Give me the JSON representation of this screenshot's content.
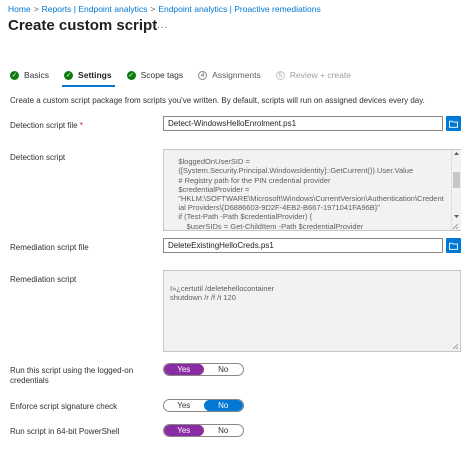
{
  "breadcrumb": {
    "items": [
      "Home",
      "Reports | Endpoint analytics",
      "Endpoint analytics | Proactive remediations"
    ],
    "separator": ">"
  },
  "page": {
    "title": "Create custom script",
    "more": "..."
  },
  "wizard": {
    "steps": [
      {
        "number": "1",
        "label": "Basics",
        "state": "done"
      },
      {
        "number": "2",
        "label": "Settings",
        "state": "current"
      },
      {
        "number": "3",
        "label": "Scope tags",
        "state": "done"
      },
      {
        "number": "4",
        "label": "Assignments",
        "state": "pending"
      },
      {
        "number": "5",
        "label": "Review + create",
        "state": "disabled"
      }
    ],
    "check": "✓"
  },
  "description": "Create a custom script package from scripts you've written. By default, scripts will run on assigned devices every day.",
  "form": {
    "detection_file": {
      "label": "Detection script file",
      "required_mark": "*",
      "value": "Detect-WindowsHelloEnrolment.ps1"
    },
    "detection_script": {
      "label": "Detection script",
      "lines": [
        "    $loggedOnUserSID =",
        "    ([System.Security.Principal.WindowsIdentity]::GetCurrent()).User.Value",
        "    # Registry path for the PIN credential provider",
        "    $credentialProvider =",
        "    \"HKLM:\\SOFTWARE\\Microsoft\\Windows\\CurrentVersion\\Authentication\\Credent",
        "    ial Providers\\{D6886603-9D2F-4EB2-B667-1971041FA96B}\"",
        "    if (Test-Path -Path $credentialProvider) {",
        "        $userSIDs = Get-ChildItem -Path $credentialProvider"
      ]
    },
    "remediation_file": {
      "label": "Remediation script file",
      "value": "DeleteExistingHelloCreds.ps1"
    },
    "remediation_script": {
      "label": "Remediation script",
      "lines": [
        "ï»¿certutil /deletehellocontainer",
        "shutdown /r /f /t 120"
      ]
    },
    "run_logged_on": {
      "label": "Run this script using the logged-on credentials",
      "yes": "Yes",
      "no": "No",
      "selected": "Yes",
      "accent": "#8a2da5"
    },
    "enforce_signature": {
      "label": "Enforce script signature check",
      "yes": "Yes",
      "no": "No",
      "selected": "No",
      "accent": "#0078d4"
    },
    "run_64bit": {
      "label": "Run script in 64-bit PowerShell",
      "yes": "Yes",
      "no": "No",
      "selected": "Yes",
      "accent": "#8a2da5"
    }
  },
  "icons": {
    "folder": "folder-icon",
    "check": "checkmark-icon",
    "more": "more-icon"
  }
}
